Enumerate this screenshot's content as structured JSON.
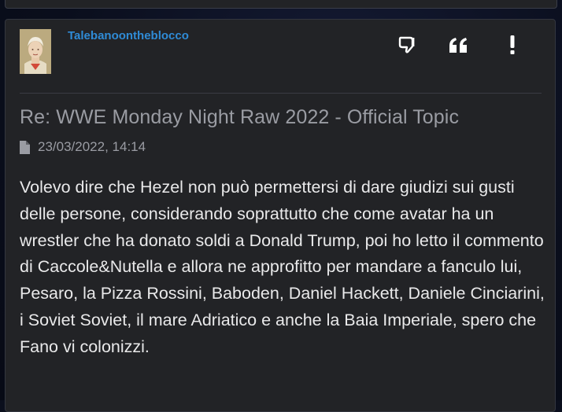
{
  "post": {
    "username": "Talebanoontheblocco",
    "title": "Re: WWE Monday Night Raw 2022 - Official Topic",
    "date": "23/03/2022, 14:14",
    "body": "Volevo dire che Hezel non può permettersi di dare giudizi sui gusti delle persone, considerando soprattutto che come avatar ha un wrestler che ha donato soldi a Donald Trump, poi ho letto il commento di Caccole&Nutella e allora ne approfitto per mandare a fanculo lui, Pesaro, la Pizza Rossini, Baboden, Daniel Hackett, Daniele Cinciarini, i Soviet Soviet, il mare Adriatico e anche la Baia Imperiale, spero che Fano vi colonizzi."
  },
  "icons": {
    "avatar": "user-avatar-portrait",
    "dislike": "thumbs-down-icon",
    "quote": "quote-icon",
    "report": "exclamation-icon",
    "date": "document-icon"
  },
  "colors": {
    "username": "#2f8bd6",
    "card_bg": "#222326",
    "title": "#9a9ca3",
    "body_text": "#e9e9ea"
  }
}
